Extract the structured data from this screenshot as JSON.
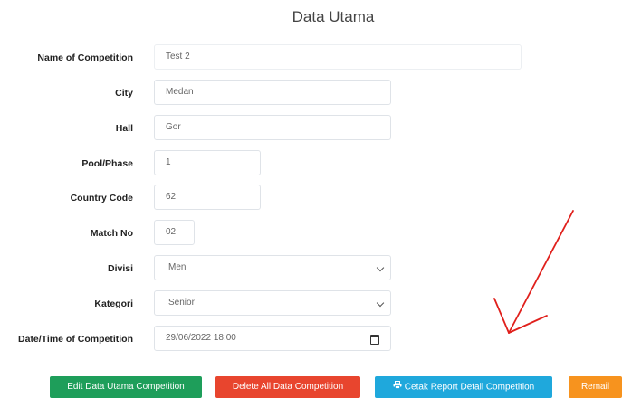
{
  "page": {
    "title": "Data Utama"
  },
  "fields": [
    {
      "id": "name",
      "label": "Name of Competition",
      "value": "Test 2",
      "type": "text"
    },
    {
      "id": "city",
      "label": "City",
      "value": "Medan",
      "type": "text"
    },
    {
      "id": "hall",
      "label": "Hall",
      "value": "Gor",
      "type": "text"
    },
    {
      "id": "pool",
      "label": "Pool/Phase",
      "value": "1",
      "type": "text"
    },
    {
      "id": "country",
      "label": "Country Code",
      "value": "62",
      "type": "text"
    },
    {
      "id": "match",
      "label": "Match No",
      "value": "02",
      "type": "text"
    },
    {
      "id": "divisi",
      "label": "Divisi",
      "value": "Men",
      "type": "select"
    },
    {
      "id": "kategori",
      "label": "Kategori",
      "value": "Senior",
      "type": "select"
    },
    {
      "id": "datetime",
      "label": "Date/Time of Competition",
      "value": "29/06/2022 18:00",
      "type": "datetime"
    }
  ],
  "buttons": {
    "edit": {
      "label": "Edit Data Utama Competition",
      "color": "#1e9e5a"
    },
    "delete": {
      "label": "Delete All Data Competition",
      "color": "#e8452e"
    },
    "report": {
      "label": "Cetak Report Detail Competition",
      "color": "#1fa8dc",
      "icon": "printer-icon"
    },
    "remail": {
      "label": "Remail",
      "color": "#f7931e"
    }
  },
  "annotation": {
    "color": "#e0201c",
    "icon": "red-arrow-annotation"
  }
}
